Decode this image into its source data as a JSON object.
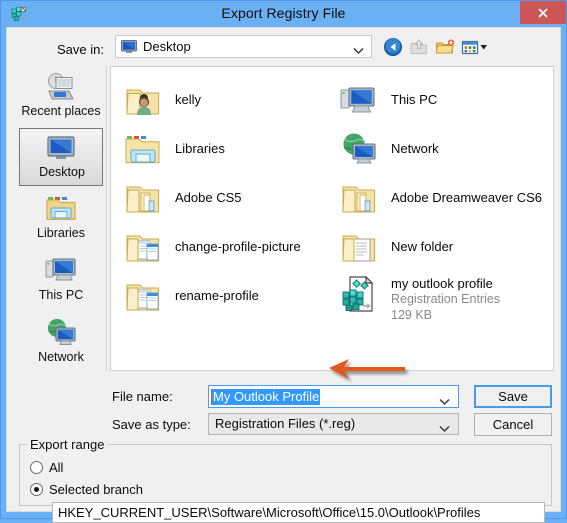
{
  "window": {
    "title": "Export Registry File",
    "icon": "registry-editor-icon",
    "close_label": "✕",
    "accent_blue": "#6cb0f4",
    "close_red": "#cc5555"
  },
  "toolbar": {
    "save_in_label": "Save in:",
    "save_in_value": "Desktop",
    "buttons": [
      {
        "name": "back-icon",
        "title": "Back"
      },
      {
        "name": "up-folder-icon",
        "title": "Up one level"
      },
      {
        "name": "new-folder-icon",
        "title": "Create New Folder"
      },
      {
        "name": "views-icon",
        "title": "Views"
      }
    ]
  },
  "places": {
    "items": [
      {
        "label": "Recent places",
        "icon": "recent-places-icon",
        "selected": false
      },
      {
        "label": "Desktop",
        "icon": "desktop-icon",
        "selected": true
      },
      {
        "label": "Libraries",
        "icon": "libraries-icon",
        "selected": false
      },
      {
        "label": "This PC",
        "icon": "this-pc-icon",
        "selected": false
      },
      {
        "label": "Network",
        "icon": "network-icon",
        "selected": false
      }
    ]
  },
  "filelist": {
    "items": [
      {
        "name": "kelly",
        "icon": "folder-user-icon",
        "col": 0,
        "row": 0
      },
      {
        "name": "Libraries",
        "icon": "libraries-folder-icon",
        "col": 0,
        "row": 1
      },
      {
        "name": "Adobe CS5",
        "icon": "folder-icon",
        "col": 0,
        "row": 2
      },
      {
        "name": "change-profile-picture",
        "icon": "folder-docs-icon",
        "col": 0,
        "row": 3
      },
      {
        "name": "rename-profile",
        "icon": "folder-docs-icon",
        "col": 0,
        "row": 4
      },
      {
        "name": "This PC",
        "icon": "this-pc-icon",
        "col": 1,
        "row": 0
      },
      {
        "name": "Network",
        "icon": "network-icon",
        "col": 1,
        "row": 1
      },
      {
        "name": "Adobe Dreamweaver CS6",
        "icon": "folder-icon",
        "col": 1,
        "row": 2
      },
      {
        "name": "New folder",
        "icon": "folder-doc-icon",
        "col": 1,
        "row": 3
      },
      {
        "name": "my outlook profile",
        "type": "Registration Entries",
        "size": "129 KB",
        "icon": "reg-file-icon",
        "col": 1,
        "row": 4,
        "detail": true
      }
    ]
  },
  "form": {
    "file_name_label": "File name:",
    "file_name_value": "My Outlook Profile",
    "save_as_type_label": "Save as type:",
    "save_as_type_value": "Registration Files (*.reg)",
    "save_button": "Save",
    "cancel_button": "Cancel"
  },
  "export_range": {
    "title": "Export range",
    "options": [
      {
        "label": "All",
        "selected": false
      },
      {
        "label": "Selected branch",
        "selected": true
      }
    ],
    "key_path": "HKEY_CURRENT_USER\\Software\\Microsoft\\Office\\15.0\\Outlook\\Profiles"
  },
  "annotation": {
    "arrow_color": "#e05a1e",
    "arrow_direction": "left",
    "points_at": "file-name-input"
  }
}
